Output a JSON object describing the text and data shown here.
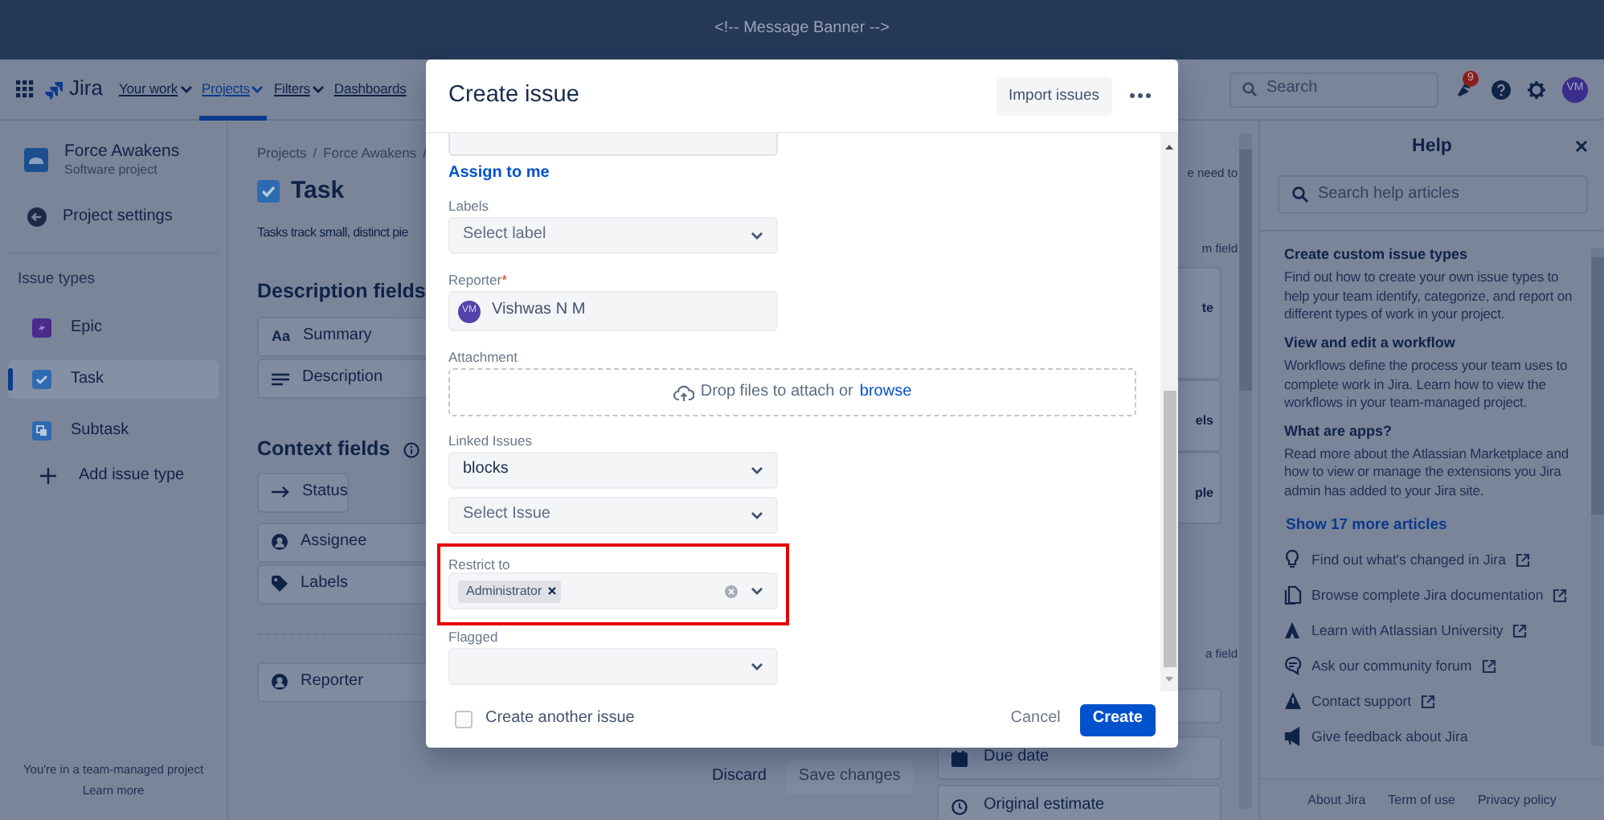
{
  "banner": {
    "text": "<!-- Message Banner -->"
  },
  "nav": {
    "logo": "Jira",
    "items": [
      {
        "label": "Your work",
        "dropdown": true,
        "selected": false
      },
      {
        "label": "Projects",
        "dropdown": true,
        "selected": true
      },
      {
        "label": "Filters",
        "dropdown": true,
        "selected": false
      },
      {
        "label": "Dashboards",
        "dropdown": false,
        "selected": false
      }
    ],
    "search": {
      "placeholder": "Search"
    },
    "notification_count": "9",
    "avatar": "VM"
  },
  "sidebar": {
    "project": {
      "name": "Force Awakens",
      "type": "Software project"
    },
    "settings": "Project settings",
    "section": "Issue types",
    "items": [
      {
        "kind": "epic",
        "label": "Epic",
        "selected": false
      },
      {
        "kind": "task",
        "label": "Task",
        "selected": true
      },
      {
        "kind": "subtask",
        "label": "Subtask",
        "selected": false
      }
    ],
    "add": "Add issue type",
    "footer": {
      "text": "You're in a team-managed project",
      "link": "Learn more"
    }
  },
  "main": {
    "breadcrumbs": [
      "Projects",
      "/",
      "Force Awakens",
      "/"
    ],
    "title": "Task",
    "description": "Tasks track small, distinct pie",
    "description_fields": {
      "heading": "Description fields",
      "items": [
        {
          "kind": "summary",
          "glyph": "Aa",
          "label": "Summary"
        },
        {
          "kind": "description",
          "label": "Description"
        }
      ]
    },
    "context_fields": {
      "heading": "Context fields",
      "items": [
        {
          "kind": "status",
          "label": "Status"
        },
        {
          "kind": "assignee",
          "label": "Assignee"
        },
        {
          "kind": "labels",
          "label": "Labels"
        }
      ]
    },
    "reporter_field": {
      "label": "Reporter"
    },
    "actions": {
      "discard": "Discard",
      "save": "Save changes"
    },
    "right_column": [
      {
        "kind": "text",
        "text": "e need to"
      },
      {
        "kind": "text",
        "text": "m field"
      },
      {
        "kind": "card",
        "text": "te"
      },
      {
        "kind": "card",
        "text": "els"
      },
      {
        "kind": "card",
        "text": "ple"
      },
      {
        "kind": "text",
        "text": "a field"
      },
      {
        "kind": "card"
      },
      {
        "kind": "due_row",
        "label": "Due date"
      },
      {
        "kind": "estimate_row",
        "label": "Original estimate"
      }
    ]
  },
  "help": {
    "title": "Help",
    "search": {
      "placeholder": "Search help articles"
    },
    "articles": [
      {
        "title": "Create custom issue types",
        "body": "Find out how to create your own issue types to help your team identify, categorize, and report on different types of work in your project."
      },
      {
        "title": "View and edit a workflow",
        "body": "Workflows define the process your team uses to complete work in Jira. Learn how to view the workflows in your team-managed project."
      },
      {
        "title": "What are apps?",
        "body": "Read more about the Atlassian Marketplace and how to view or manage the extensions you Jira admin has added to your Jira site."
      }
    ],
    "more": "Show 17 more articles",
    "links": [
      {
        "kind": "bulb",
        "label": "Find out what's changed in Jira",
        "external": true
      },
      {
        "kind": "docs",
        "label": "Browse complete Jira documentation",
        "external": true
      },
      {
        "kind": "university",
        "label": "Learn with Atlassian University",
        "external": true
      },
      {
        "kind": "forum",
        "label": "Ask our community forum",
        "external": true
      },
      {
        "kind": "support",
        "label": "Contact support",
        "external": true
      },
      {
        "kind": "feedback",
        "label": "Give feedback about Jira",
        "external": false
      }
    ],
    "footer": [
      "About Jira",
      "Term of use",
      "Privacy policy"
    ]
  },
  "modal": {
    "title": "Create issue",
    "import": "Import issues",
    "assign_link": "Assign to me",
    "fields": [
      {
        "kind": "select",
        "label": "Labels",
        "placeholder": "Select label"
      },
      {
        "kind": "user",
        "label": "Reporter",
        "required_mark": "*",
        "avatar": "VM",
        "value": "Vishwas N M"
      },
      {
        "kind": "dropzone",
        "label": "Attachment",
        "text": "Drop files to attach or",
        "link": "browse"
      },
      {
        "kind": "select",
        "label": "Linked Issues",
        "value": "blocks"
      },
      {
        "kind": "select",
        "placeholder": "Select Issue"
      },
      {
        "kind": "multi",
        "label": "Restrict to",
        "highlighted": true,
        "chips": [
          "Administrator"
        ]
      },
      {
        "kind": "select",
        "label": "Flagged"
      }
    ],
    "create_another": {
      "label": "Create another issue",
      "checked": false
    },
    "cancel": "Cancel",
    "create": "Create"
  }
}
